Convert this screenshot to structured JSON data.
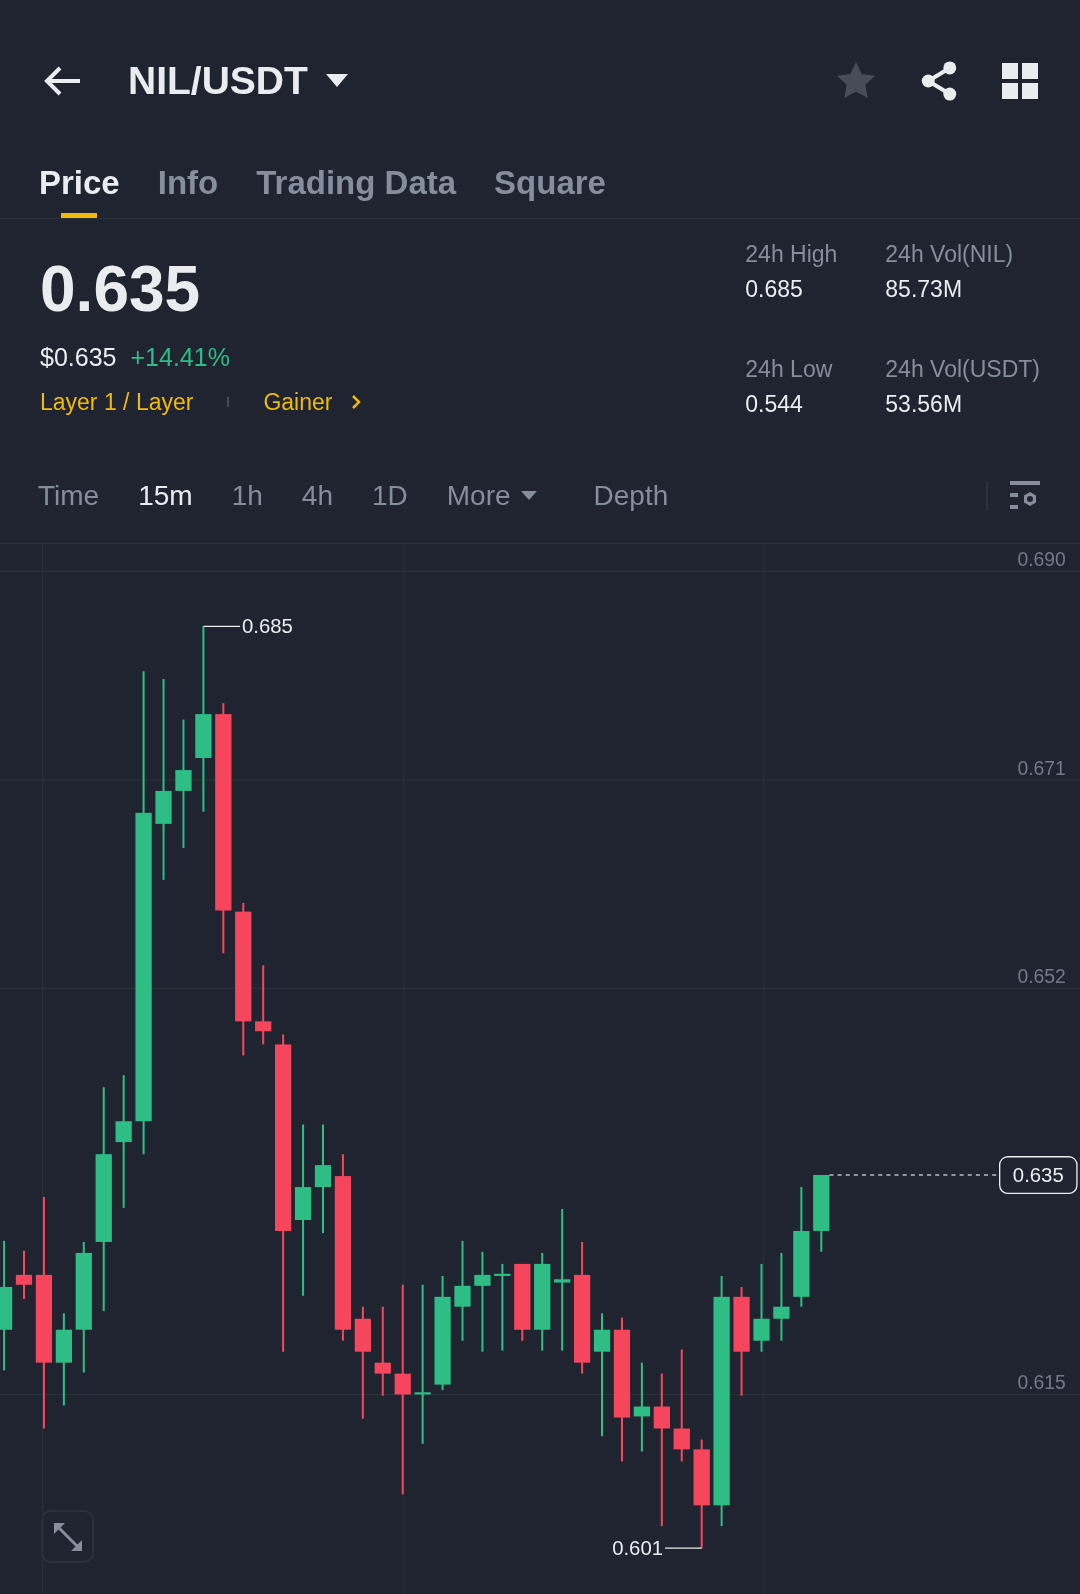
{
  "header": {
    "title": "NIL/USDT",
    "favorite": false
  },
  "tabs": [
    {
      "label": "Price",
      "selected": true
    },
    {
      "label": "Info",
      "selected": false
    },
    {
      "label": "Trading Data",
      "selected": false
    },
    {
      "label": "Square",
      "selected": false
    }
  ],
  "ticker": {
    "price": "0.635",
    "fiat_price": "$0.635",
    "change": "+14.41%",
    "tags": [
      "Layer 1 / Layer",
      "Gainer"
    ]
  },
  "stats": [
    {
      "label": "24h High",
      "value": "0.685"
    },
    {
      "label": "24h Vol(NIL)",
      "value": "85.73M"
    },
    {
      "label": "24h Low",
      "value": "0.544"
    },
    {
      "label": "24h Vol(USDT)",
      "value": "53.56M"
    }
  ],
  "intervals": [
    {
      "label": "Time",
      "selected": false,
      "kind": "plain"
    },
    {
      "label": "15m",
      "selected": true,
      "kind": "plain"
    },
    {
      "label": "1h",
      "selected": false,
      "kind": "plain"
    },
    {
      "label": "4h",
      "selected": false,
      "kind": "plain"
    },
    {
      "label": "1D",
      "selected": false,
      "kind": "plain"
    },
    {
      "label": "More",
      "selected": false,
      "kind": "dropdown"
    },
    {
      "label": "Depth",
      "selected": false,
      "kind": "plain"
    }
  ],
  "chart": {
    "axis_labels": [
      "0.690",
      "0.671",
      "0.652",
      "0.615"
    ],
    "high_label": "0.685",
    "low_label": "0.601",
    "last_price_label": "0.635"
  }
}
